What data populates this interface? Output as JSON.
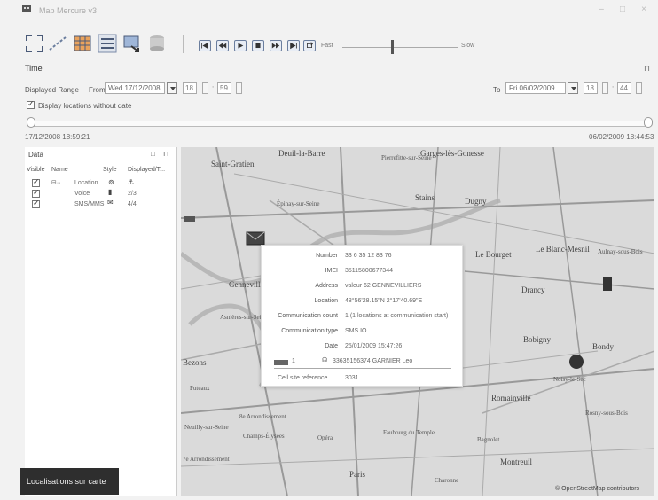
{
  "window": {
    "title": "Map Mercure v3"
  },
  "toolbar": {
    "speed_fast": "Fast",
    "speed_slow": "Slow",
    "speed_value": 0.42
  },
  "time_panel": {
    "header": "Time",
    "displayed_range_label": "Displayed Range",
    "from_label": "From",
    "from_date": "Wed 17/12/2008",
    "from_hour": "18",
    "from_minute": "59",
    "to_label": "To",
    "to_date": "Fri 06/02/2009",
    "to_hour": "18",
    "to_minute": "44",
    "display_without_date_label": "Display locations without date",
    "display_without_date_checked": true,
    "range_start": "17/12/2008 18:59:21",
    "range_end": "06/02/2009 18:44:53"
  },
  "data_panel": {
    "title": "Data",
    "columns": [
      "Visible",
      "Name",
      "Style",
      "Displayed/T..."
    ],
    "rows": [
      {
        "name": "Location",
        "style_icon": "anchor-icon",
        "count": ""
      },
      {
        "name": "Voice",
        "style_icon": "phone-icon",
        "count": "2/3"
      },
      {
        "name": "SMS/MMS",
        "style_icon": "envelope-icon",
        "count": "4/4"
      }
    ]
  },
  "popup": {
    "rows": [
      {
        "label": "Number",
        "value": "33 6 35 12 83 76"
      },
      {
        "label": "IMEI",
        "value": "35115800677344"
      },
      {
        "label": "Address",
        "value": "valeur 62 GENNEVILLIERS"
      },
      {
        "label": "Location",
        "value": "48°56'28.15\"N 2°17'40.69\"E"
      },
      {
        "label": "Communication count",
        "value": "1 (1 locations at communication start)"
      },
      {
        "label": "Communication type",
        "value": "SMS IO"
      },
      {
        "label": "Date",
        "value": "25/01/2009 15:47:26"
      }
    ],
    "sub_row_index": "1",
    "sub_row_value": "33635156374 GARNIER Leo",
    "cell_ref_label": "Cell site reference",
    "cell_ref_value": "3031"
  },
  "map": {
    "places": [
      "Saint-Gratien",
      "Deuil-la-Barre",
      "Pierrefitte-sur-Seine",
      "Garges-lès-Gonesse",
      "Stains",
      "Dugny",
      "Épinay-sur-Seine",
      "Le Bourget",
      "Le Blanc-Mesnil",
      "Aulnay-sous-Bois",
      "Drancy",
      "Gennevilliers",
      "Asnières-sur-Seine",
      "Bobigny",
      "Bondy",
      "Bezons",
      "Puteaux",
      "Rosny-sous-Bois",
      "Romainville",
      "Noisy-le-Sec",
      "Neuilly-sur-Seine",
      "8e Arrondissement",
      "Champs-Élysées",
      "Opéra",
      "Faubourg du Temple",
      "Bagnolet",
      "Montreuil",
      "Paris",
      "7e Arrondissement",
      "Charonne"
    ],
    "attribution": "© OpenStreetMap contributors"
  },
  "overlay": {
    "tooltip": "Localisations sur carte"
  }
}
